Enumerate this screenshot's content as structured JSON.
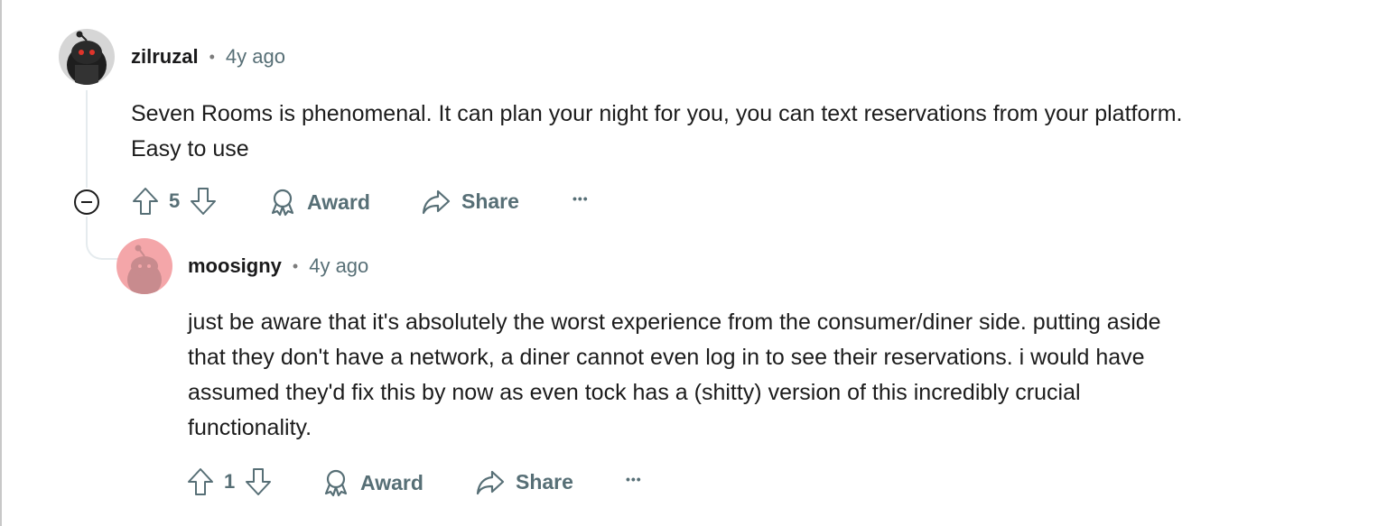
{
  "comments": [
    {
      "username": "zilruzal",
      "separator": "•",
      "time": "4y ago",
      "body_lines": [
        "Seven Rooms is phenomenal. It can plan your night for you, you can text reservations from your platform.",
        "Easy to use"
      ],
      "votes": "5",
      "award_label": "Award",
      "share_label": "Share",
      "more_label": "•••"
    },
    {
      "username": "moosigny",
      "separator": "•",
      "time": "4y ago",
      "body_lines": [
        "just be aware that it's absolutely the worst experience from the consumer/diner side. putting aside",
        "that they don't have a network, a diner cannot even log in to see their reservations. i would have",
        "assumed they'd fix this by now as even tock has a (shitty) version of this incredibly crucial",
        "functionality."
      ],
      "votes": "1",
      "award_label": "Award",
      "share_label": "Share",
      "more_label": "•••"
    }
  ],
  "colors": {
    "text": "#1c1c1c",
    "meta": "#576f76",
    "thread_line": "#e5ebee",
    "avatar_pink": "#f4a6a9"
  },
  "icons": [
    "collapse-icon",
    "upvote-icon",
    "downvote-icon",
    "award-icon",
    "share-icon",
    "more-icon"
  ]
}
